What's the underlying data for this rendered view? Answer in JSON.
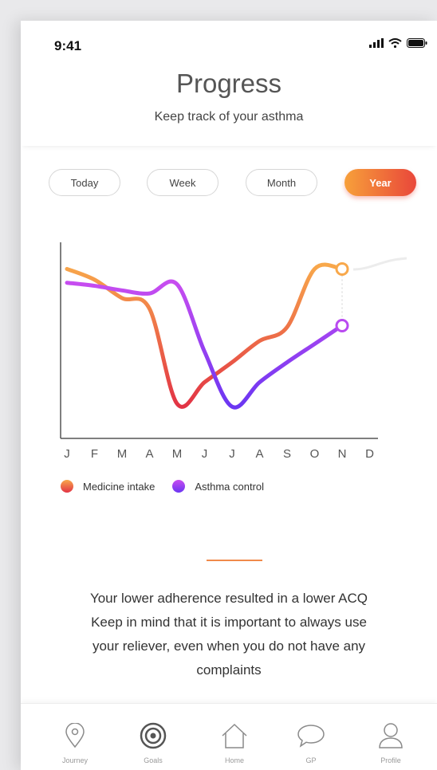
{
  "status_bar": {
    "time": "9:41"
  },
  "header": {
    "title": "Progress",
    "subtitle": "Keep track of your asthma"
  },
  "filters": [
    {
      "label": "Today",
      "active": false
    },
    {
      "label": "Week",
      "active": false
    },
    {
      "label": "Month",
      "active": false
    },
    {
      "label": "Year",
      "active": true
    }
  ],
  "chart_data": {
    "type": "line",
    "categories": [
      "J",
      "F",
      "M",
      "A",
      "M",
      "J",
      "J",
      "A",
      "S",
      "O",
      "N",
      "D"
    ],
    "ylim": [
      0,
      10
    ],
    "grid": false,
    "legend": "bottom-left",
    "series": [
      {
        "name": "Medicine intake",
        "color_start": "#f8a84b",
        "color_end": "#e23345",
        "values": [
          9.3,
          8.6,
          7.4,
          6.7,
          0.5,
          1.9,
          3.2,
          4.6,
          5.5,
          9.3,
          9.3,
          null
        ]
      },
      {
        "name": "Asthma control",
        "color_start": "#c84df0",
        "color_end": "#6a36f2",
        "values": [
          8.4,
          8.2,
          7.9,
          7.7,
          8.3,
          3.9,
          0.3,
          1.9,
          3.2,
          4.4,
          5.6,
          null
        ]
      }
    ]
  },
  "message": {
    "lines": [
      "Your lower adherence resulted in a lower ACQ",
      "Keep in mind that it is important to always use",
      "your reliever, even when you do not have any",
      "complaints"
    ]
  },
  "tab_bar": {
    "items": [
      {
        "label": "Journey",
        "icon": "location-pin-icon"
      },
      {
        "label": "Goals",
        "icon": "target-icon"
      },
      {
        "label": "Home",
        "icon": "home-icon"
      },
      {
        "label": "GP",
        "icon": "chat-bubble-icon"
      },
      {
        "label": "Profile",
        "icon": "profile-icon"
      }
    ]
  },
  "colors": {
    "accent_start": "#f7a03a",
    "accent_end": "#e9473a",
    "divider": "#f08a4b"
  }
}
